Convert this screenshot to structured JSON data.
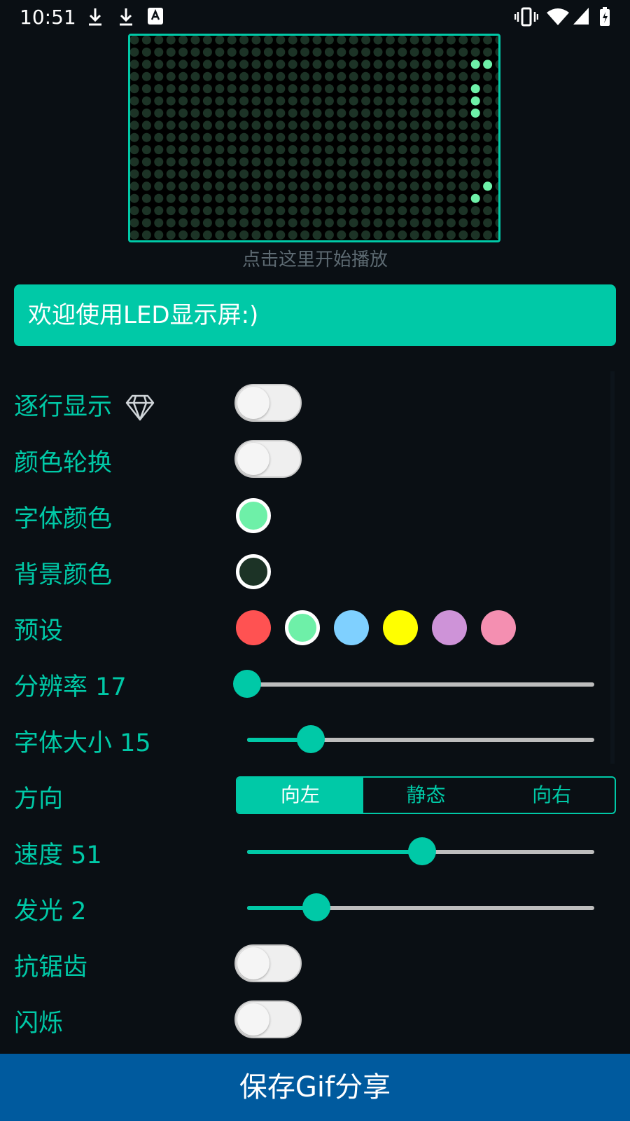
{
  "status_bar": {
    "time": "10:51"
  },
  "preview": {
    "hint": "点击这里开始播放"
  },
  "text_input": {
    "value": "欢迎使用LED显示屏:)"
  },
  "settings": {
    "line_display": {
      "label": "逐行显示",
      "on": false
    },
    "color_cycle": {
      "label": "颜色轮换",
      "on": false
    },
    "font_color": {
      "label": "字体颜色",
      "color": "#6ef0a8"
    },
    "bg_color": {
      "label": "背景颜色",
      "color": "#1c3326"
    },
    "presets": {
      "label": "预设",
      "colors": [
        "#ff5252",
        "#6ef0a8",
        "#7fd0ff",
        "#ffff00",
        "#ce93d8",
        "#f48fb1"
      ],
      "selected": 1
    },
    "resolution": {
      "label": "分辨率 17",
      "value": 17
    },
    "font_size": {
      "label": "字体大小 15",
      "value": 15
    },
    "direction": {
      "label": "方向",
      "options": [
        "向左",
        "静态",
        "向右"
      ],
      "selected": 0
    },
    "speed": {
      "label": "速度 51",
      "value": 51
    },
    "glow": {
      "label": "发光 2",
      "value": 2
    },
    "antialias": {
      "label": "抗锯齿",
      "on": false
    },
    "blink": {
      "label": "闪烁",
      "on": false
    }
  },
  "save_button": {
    "label": "保存Gif分享"
  },
  "icons": [
    "download-icon",
    "download-icon",
    "font-notification-icon",
    "vibrate-icon",
    "wifi-icon",
    "signal-icon",
    "battery-icon",
    "diamond-icon"
  ]
}
